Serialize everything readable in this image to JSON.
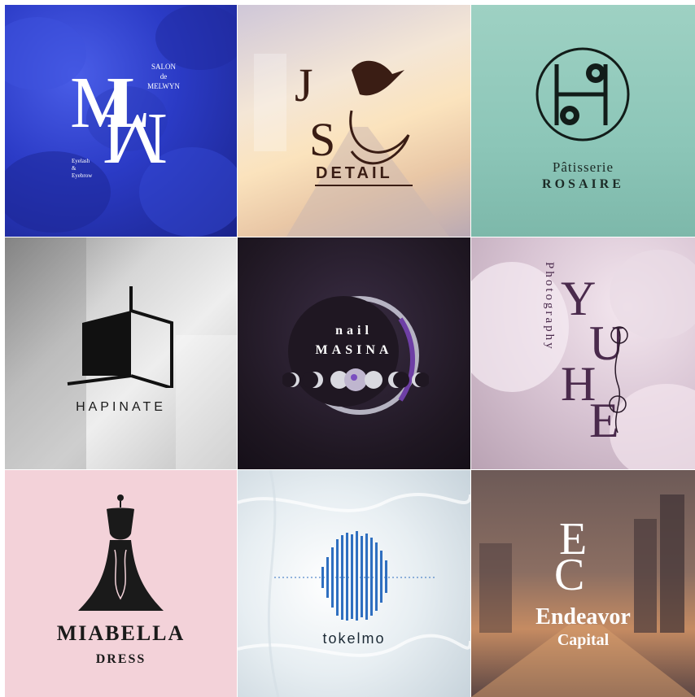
{
  "tiles": [
    {
      "id": "melwyn",
      "mono": "ML W",
      "lines": [
        "SALON",
        "de",
        "MELWYN"
      ],
      "sub": [
        "Eyelash",
        "&",
        "Eyebrow"
      ]
    },
    {
      "id": "jsu",
      "mono": "J S",
      "word": "DETAIL"
    },
    {
      "id": "rosaire",
      "line1": "Pâtisserie",
      "line2": "ROSAIRE"
    },
    {
      "id": "hapinate",
      "word": "HAPINATE"
    },
    {
      "id": "masina",
      "line1": "nail",
      "line2": "MASINA"
    },
    {
      "id": "yuhee",
      "vertical": "Photography",
      "mono": "YU HEE"
    },
    {
      "id": "miabella",
      "line1": "MIABELLA",
      "line2": "DRESS"
    },
    {
      "id": "tokelmo",
      "word": "tokelmo"
    },
    {
      "id": "endeavor",
      "mono": "EC",
      "line1": "Endeavor",
      "line2": "Capital"
    }
  ],
  "colors": {
    "melwyn_bg": "#2b3bc6",
    "jsu_ink": "#3a1d14",
    "rosaire_bg": "#8cc6b8",
    "masina_bg": "#1f1722",
    "yuhee_ink": "#4a2a4c",
    "miabella_bg": "#f3d2d9",
    "tokelmo_blue": "#2f6fc0",
    "endeavor_bg": "#8b6e62"
  }
}
